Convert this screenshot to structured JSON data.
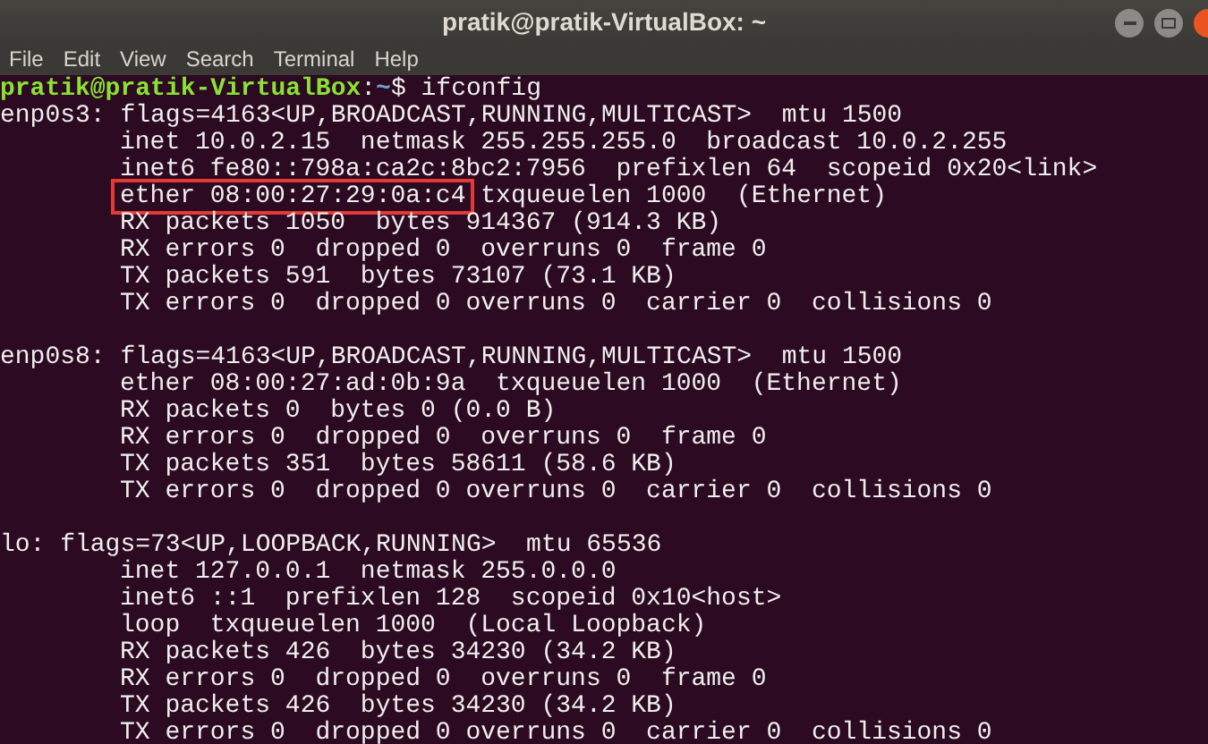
{
  "window": {
    "title": "pratik@pratik-VirtualBox: ~"
  },
  "menu": [
    "File",
    "Edit",
    "View",
    "Search",
    "Terminal",
    "Help"
  ],
  "prompt": {
    "user_host": "pratik@pratik-VirtualBox",
    "separator": ":",
    "path": "~",
    "symbol": "$",
    "command": "ifconfig"
  },
  "interfaces": [
    {
      "header": "enp0s3: flags=4163<UP,BROADCAST,RUNNING,MULTICAST>  mtu 1500",
      "details": [
        [
          {
            "text": "inet 10.0.2.15  netmask 255.255.255.0  broadcast 10.0.2.255",
            "highlighted": false
          }
        ],
        [
          {
            "text": "inet6 fe80::798a:ca2c:8bc2:7956  prefixlen 64  scopeid 0x20<link>",
            "highlighted": false
          }
        ],
        [
          {
            "text": "ether 08:00:27:29:0a:c4",
            "highlighted": true
          },
          {
            "text": " txqueuelen 1000  (Ethernet)",
            "highlighted": false
          }
        ],
        [
          {
            "text": "RX packets 1050  bytes 914367 (914.3 KB)",
            "highlighted": false
          }
        ],
        [
          {
            "text": "RX errors 0  dropped 0  overruns 0  frame 0",
            "highlighted": false
          }
        ],
        [
          {
            "text": "TX packets 591  bytes 73107 (73.1 KB)",
            "highlighted": false
          }
        ],
        [
          {
            "text": "TX errors 0  dropped 0 overruns 0  carrier 0  collisions 0",
            "highlighted": false
          }
        ]
      ]
    },
    {
      "header": "enp0s8: flags=4163<UP,BROADCAST,RUNNING,MULTICAST>  mtu 1500",
      "details": [
        [
          {
            "text": "ether 08:00:27:ad:0b:9a  txqueuelen 1000  (Ethernet)",
            "highlighted": false
          }
        ],
        [
          {
            "text": "RX packets 0  bytes 0 (0.0 B)",
            "highlighted": false
          }
        ],
        [
          {
            "text": "RX errors 0  dropped 0  overruns 0  frame 0",
            "highlighted": false
          }
        ],
        [
          {
            "text": "TX packets 351  bytes 58611 (58.6 KB)",
            "highlighted": false
          }
        ],
        [
          {
            "text": "TX errors 0  dropped 0 overruns 0  carrier 0  collisions 0",
            "highlighted": false
          }
        ]
      ]
    },
    {
      "header": "lo: flags=73<UP,LOOPBACK,RUNNING>  mtu 65536",
      "details": [
        [
          {
            "text": "inet 127.0.0.1  netmask 255.0.0.0",
            "highlighted": false
          }
        ],
        [
          {
            "text": "inet6 ::1  prefixlen 128  scopeid 0x10<host>",
            "highlighted": false
          }
        ],
        [
          {
            "text": "loop  txqueuelen 1000  (Local Loopback)",
            "highlighted": false
          }
        ],
        [
          {
            "text": "RX packets 426  bytes 34230 (34.2 KB)",
            "highlighted": false
          }
        ],
        [
          {
            "text": "RX errors 0  dropped 0  overruns 0  frame 0",
            "highlighted": false
          }
        ],
        [
          {
            "text": "TX packets 426  bytes 34230 (34.2 KB)",
            "highlighted": false
          }
        ],
        [
          {
            "text": "TX errors 0  dropped 0 overruns 0  carrier 0  collisions 0",
            "highlighted": false
          }
        ]
      ]
    }
  ]
}
